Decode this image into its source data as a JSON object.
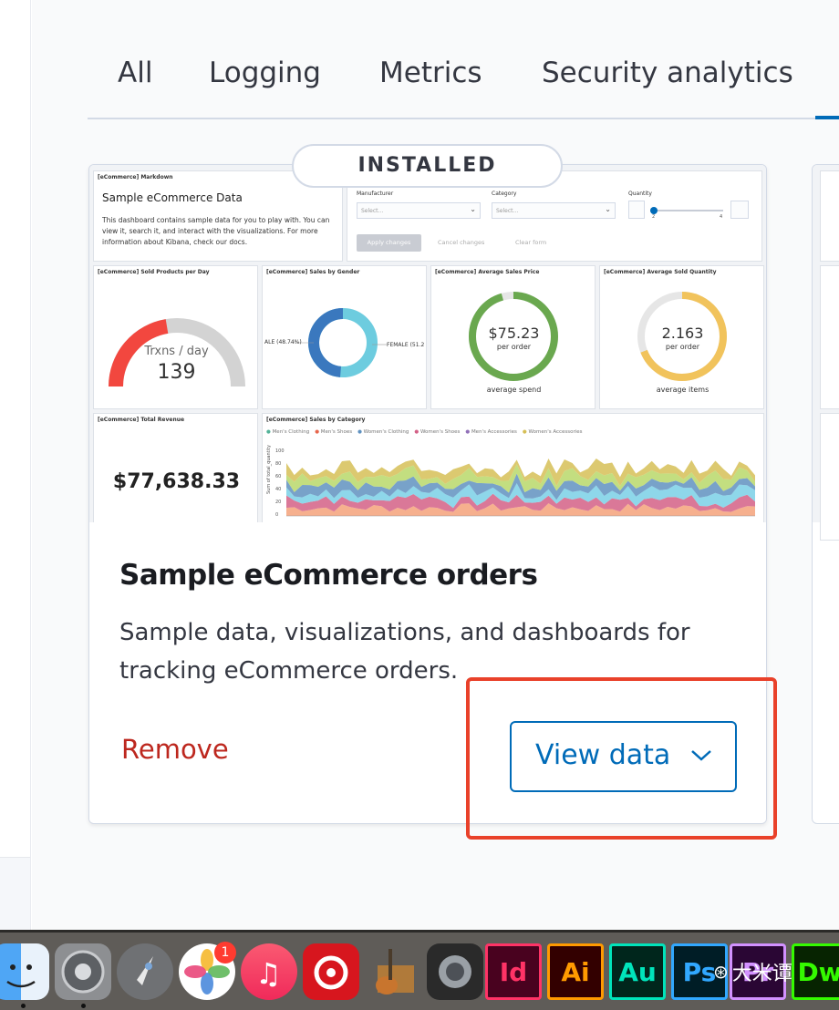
{
  "tabs": [
    {
      "label": "All"
    },
    {
      "label": "Logging"
    },
    {
      "label": "Metrics"
    },
    {
      "label": "Security analytics"
    }
  ],
  "card": {
    "badge": "INSTALLED",
    "title": "Sample eCommerce orders",
    "description": "Sample data, visualizations, and dashboards for tracking eCommerce orders.",
    "remove_label": "Remove",
    "view_label": "View data"
  },
  "preview": {
    "markdown": {
      "panel_title": "[eCommerce] Markdown",
      "heading": "Sample eCommerce Data",
      "text": "This dashboard contains sample data for you to play with. You can view it, search it, and interact with the visualizations. For more information about Kibana, check our docs."
    },
    "controls": {
      "manufacturer_label": "Manufacturer",
      "category_label": "Category",
      "quantity_label": "Quantity",
      "select_placeholder": "Select...",
      "apply": "Apply changes",
      "cancel": "Cancel changes",
      "clear": "Clear form",
      "slider_min": "2",
      "slider_max": "4"
    },
    "sold_per_day": {
      "panel_title": "[eCommerce] Sold Products per Day",
      "unit": "Trxns / day",
      "value": "139"
    },
    "sales_by_gender": {
      "panel_title": "[eCommerce] Sales by Gender",
      "male": "ALE (48.74%)",
      "female": "FEMALE (51.2"
    },
    "avg_sales_price": {
      "panel_title": "[eCommerce] Average Sales Price",
      "value": "$75.23",
      "sub": "per order",
      "caption": "average spend"
    },
    "avg_sold_qty": {
      "panel_title": "[eCommerce] Average Sold Quantity",
      "value": "2.163",
      "sub": "per order",
      "caption": "average items"
    },
    "total_revenue": {
      "panel_title": "[eCommerce] Total Revenue",
      "value": "$77,638.33"
    },
    "sales_by_category": {
      "panel_title": "[eCommerce] Sales by Category",
      "legend": [
        "Men's Clothing",
        "Men's Shoes",
        "Women's Clothing",
        "Women's Shoes",
        "Men's Accessories",
        "Women's Accessories"
      ],
      "legend_colors": [
        "#54b399",
        "#e7664c",
        "#6092c0",
        "#d36086",
        "#9170b8",
        "#d6bf57"
      ],
      "y_ticks": [
        "100",
        "80",
        "60",
        "40",
        "20",
        "0"
      ],
      "y_label": "Sum of total_quantity"
    }
  },
  "dock": {
    "items": [
      "finder-icon",
      "system-preferences-icon",
      "launchpad-icon",
      "photos-icon",
      "music-icon",
      "netease-music-icon",
      "garageband-icon",
      "logic-pro-icon",
      "indesign-icon",
      "illustrator-icon",
      "audition-icon",
      "photoshop-icon",
      "premiere-icon",
      "dreamweaver-icon"
    ],
    "photos_badge": "1",
    "adobe": {
      "id": "Id",
      "ai": "Ai",
      "au": "Au",
      "ps": "Ps",
      "pr": "Pr",
      "dw": "Dw"
    },
    "watermark": "大米谭"
  },
  "colors": {
    "accent": "#006bb8",
    "danger": "#bd271e",
    "highlight": "#e9412a"
  }
}
